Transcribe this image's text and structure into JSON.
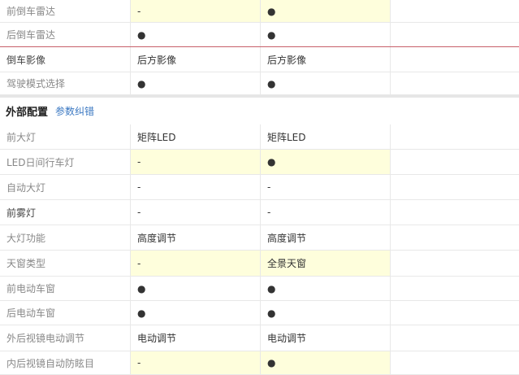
{
  "section": {
    "title": "外部配置",
    "link": "参数纠错"
  },
  "rows_top": [
    {
      "label": "前倒车雷达",
      "v1": "-",
      "v2": "●",
      "v3": "",
      "hl": true,
      "dark": false
    },
    {
      "label": "后倒车雷达",
      "v1": "●",
      "v2": "●",
      "v3": "",
      "hl": false,
      "dark": false
    },
    {
      "label": "倒车影像",
      "v1": "后方影像",
      "v2": "后方影像",
      "v3": "",
      "hl": false,
      "dark": true
    },
    {
      "label": "驾驶模式选择",
      "v1": "●",
      "v2": "●",
      "v3": "",
      "hl": false,
      "dark": false
    }
  ],
  "rows_bottom": [
    {
      "label": "前大灯",
      "v1": "矩阵LED",
      "v2": "矩阵LED",
      "v3": "",
      "hl": false,
      "dark": false
    },
    {
      "label": "LED日间行车灯",
      "v1": "-",
      "v2": "●",
      "v3": "",
      "hl": true,
      "dark": false
    },
    {
      "label": "自动大灯",
      "v1": "-",
      "v2": "-",
      "v3": "",
      "hl": false,
      "dark": false
    },
    {
      "label": "前雾灯",
      "v1": "-",
      "v2": "-",
      "v3": "",
      "hl": false,
      "dark": true
    },
    {
      "label": "大灯功能",
      "v1": "高度调节",
      "v2": "高度调节",
      "v3": "",
      "hl": false,
      "dark": false
    },
    {
      "label": "天窗类型",
      "v1": "-",
      "v2": "全景天窗",
      "v3": "",
      "hl": true,
      "dark": false
    },
    {
      "label": "前电动车窗",
      "v1": "●",
      "v2": "●",
      "v3": "",
      "hl": false,
      "dark": false
    },
    {
      "label": "后电动车窗",
      "v1": "●",
      "v2": "●",
      "v3": "",
      "hl": false,
      "dark": false
    },
    {
      "label": "外后视镜电动调节",
      "v1": "电动调节",
      "v2": "电动调节",
      "v3": "",
      "hl": false,
      "dark": false
    },
    {
      "label": "内后视镜自动防眩目",
      "v1": "-",
      "v2": "●",
      "v3": "",
      "hl": true,
      "dark": false
    }
  ]
}
